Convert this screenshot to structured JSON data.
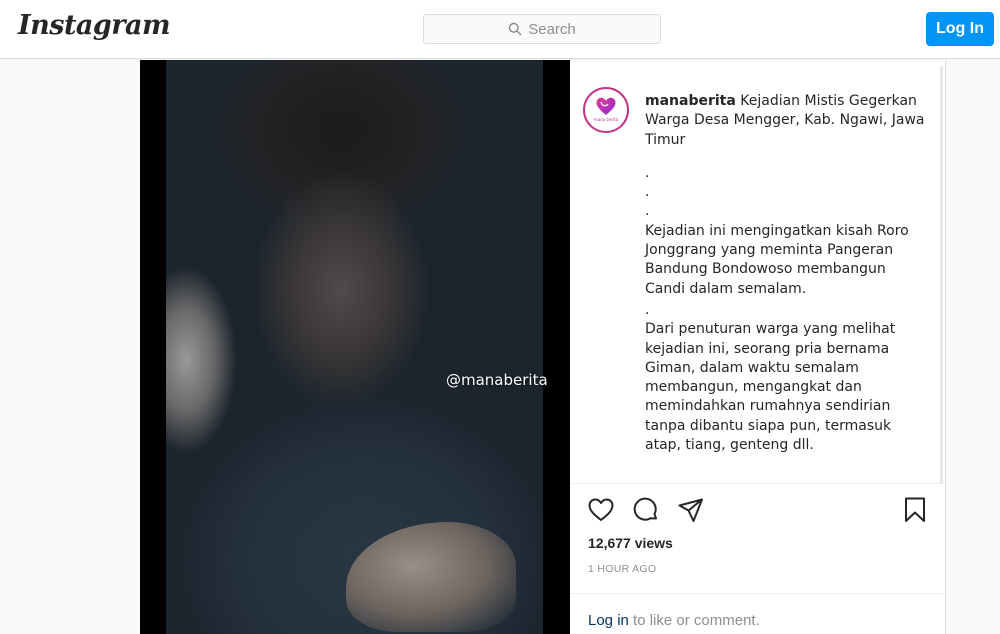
{
  "header": {
    "logo": "Instagram",
    "search": {
      "placeholder": "Search"
    },
    "login_label": "Log In"
  },
  "video": {
    "watermark": "@manaberita"
  },
  "post": {
    "avatar_text": "mana berita",
    "username": "manaberita",
    "title": "Kejadian Mistis Gegerkan Warga Desa Mengger, Kab. Ngawi, Jawa Timur",
    "dots": ".\n.\n.",
    "paragraph_1": "Kejadian ini mengingatkan kisah Roro Jonggrang yang meminta Pangeran Bandung Bondowoso membangun Candi dalam semalam.",
    "dot_separator": ".",
    "paragraph_2": "Dari penuturan warga yang melihat kejadian ini, seorang pria bernama Giman, dalam waktu semalam membangun, mengangkat dan memindahkan rumahnya sendirian tanpa dibantu siapa pun, termasuk atap, tiang, genteng dll.",
    "views": "12,677 views",
    "timestamp": "1 HOUR AGO",
    "login_link": "Log in",
    "comment_suffix": " to like or comment."
  },
  "icons": [
    "search-icon",
    "heart-icon",
    "comment-icon",
    "share-icon",
    "bookmark-icon"
  ],
  "colors": {
    "accent": "#0095f6",
    "link": "#00376b",
    "muted": "#8e8e8e",
    "avatar_ring": "#c13584"
  }
}
